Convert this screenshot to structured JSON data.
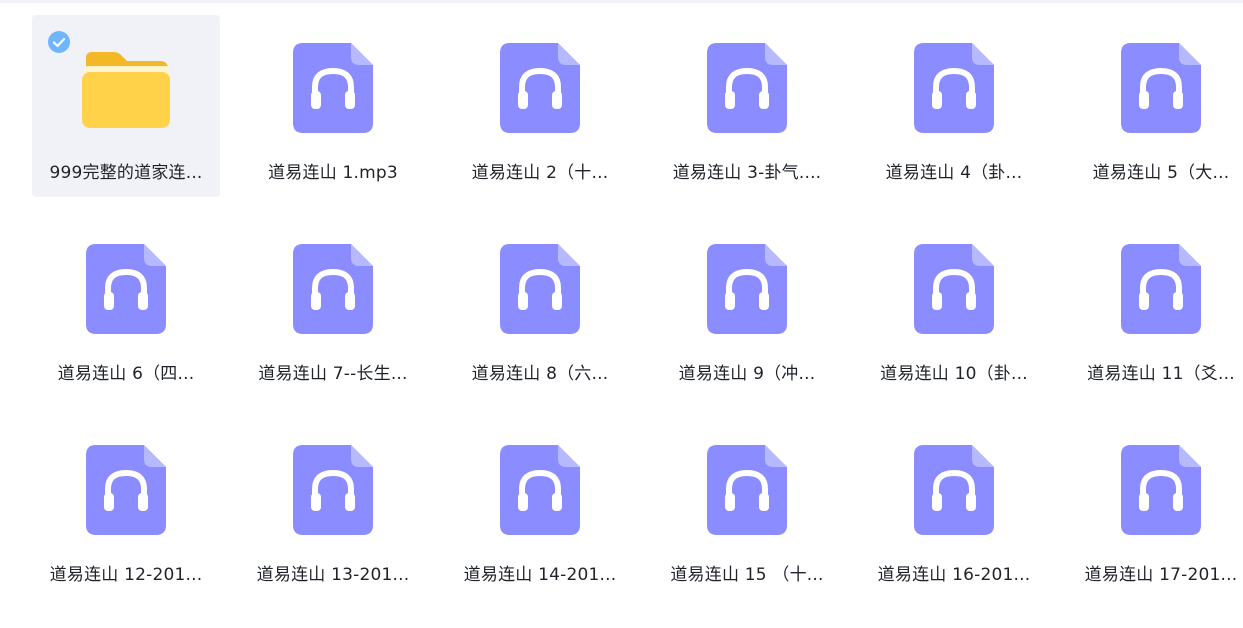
{
  "colors": {
    "audio_icon_fill": "#8a8cff",
    "audio_icon_fold": "#b7b9ff",
    "folder_yellow": "#ffd24a",
    "check_blue": "#6fb6ff",
    "selected_bg": "#f0f2f8"
  },
  "items": [
    {
      "label": "999完整的道家连...",
      "type": "folder",
      "icon": "folder-icon",
      "selected": true
    },
    {
      "label": "道易连山 1.mp3",
      "type": "audio",
      "icon": "headphones-audio-file-icon"
    },
    {
      "label": "道易连山 2（十...",
      "type": "audio",
      "icon": "headphones-audio-file-icon"
    },
    {
      "label": "道易连山 3-卦气....",
      "type": "audio",
      "icon": "headphones-audio-file-icon"
    },
    {
      "label": "道易连山 4（卦...",
      "type": "audio",
      "icon": "headphones-audio-file-icon"
    },
    {
      "label": "道易连山 5（大...",
      "type": "audio",
      "icon": "headphones-audio-file-icon"
    },
    {
      "label": "道易连山 6（四...",
      "type": "audio",
      "icon": "headphones-audio-file-icon"
    },
    {
      "label": "道易连山 7--长生...",
      "type": "audio",
      "icon": "headphones-audio-file-icon"
    },
    {
      "label": "道易连山 8（六...",
      "type": "audio",
      "icon": "headphones-audio-file-icon"
    },
    {
      "label": "道易连山 9（冲...",
      "type": "audio",
      "icon": "headphones-audio-file-icon"
    },
    {
      "label": "道易连山 10（卦...",
      "type": "audio",
      "icon": "headphones-audio-file-icon"
    },
    {
      "label": "道易连山 11（爻...",
      "type": "audio",
      "icon": "headphones-audio-file-icon"
    },
    {
      "label": "道易连山 12-201...",
      "type": "audio",
      "icon": "headphones-audio-file-icon"
    },
    {
      "label": "道易连山 13-201...",
      "type": "audio",
      "icon": "headphones-audio-file-icon"
    },
    {
      "label": "道易连山 14-201...",
      "type": "audio",
      "icon": "headphones-audio-file-icon"
    },
    {
      "label": "道易连山 15 （十...",
      "type": "audio",
      "icon": "headphones-audio-file-icon"
    },
    {
      "label": "道易连山 16-201...",
      "type": "audio",
      "icon": "headphones-audio-file-icon"
    },
    {
      "label": "道易连山 17-201...",
      "type": "audio",
      "icon": "headphones-audio-file-icon"
    }
  ]
}
